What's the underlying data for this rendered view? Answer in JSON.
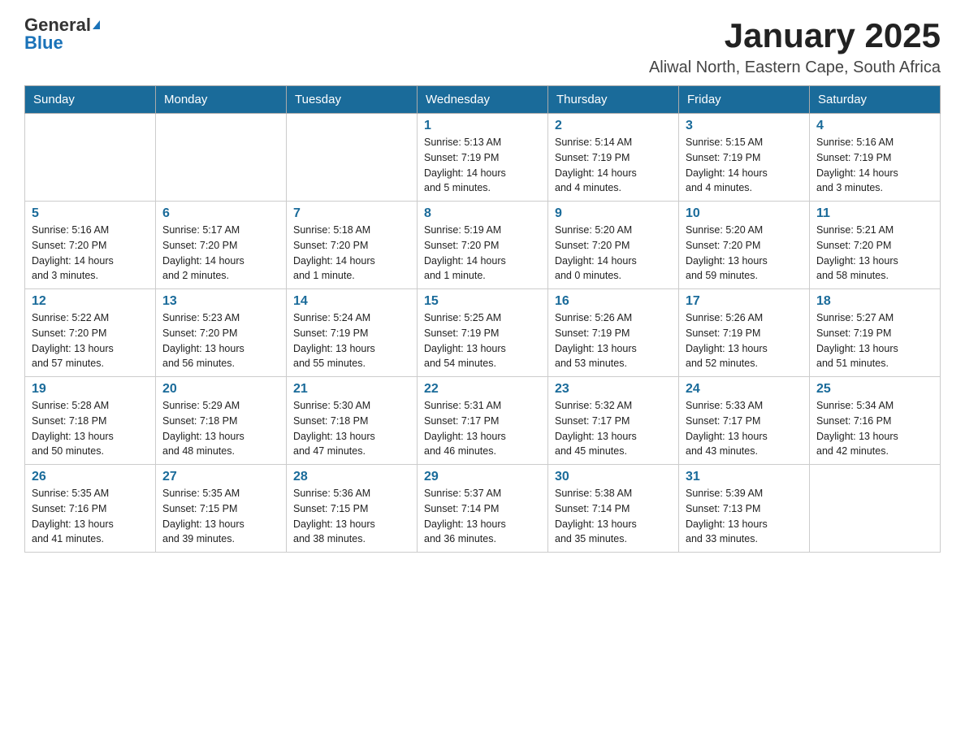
{
  "header": {
    "logo_general": "General",
    "logo_blue": "Blue",
    "main_title": "January 2025",
    "subtitle": "Aliwal North, Eastern Cape, South Africa"
  },
  "weekdays": [
    "Sunday",
    "Monday",
    "Tuesday",
    "Wednesday",
    "Thursday",
    "Friday",
    "Saturday"
  ],
  "weeks": [
    [
      {
        "day": "",
        "info": ""
      },
      {
        "day": "",
        "info": ""
      },
      {
        "day": "",
        "info": ""
      },
      {
        "day": "1",
        "info": "Sunrise: 5:13 AM\nSunset: 7:19 PM\nDaylight: 14 hours\nand 5 minutes."
      },
      {
        "day": "2",
        "info": "Sunrise: 5:14 AM\nSunset: 7:19 PM\nDaylight: 14 hours\nand 4 minutes."
      },
      {
        "day": "3",
        "info": "Sunrise: 5:15 AM\nSunset: 7:19 PM\nDaylight: 14 hours\nand 4 minutes."
      },
      {
        "day": "4",
        "info": "Sunrise: 5:16 AM\nSunset: 7:19 PM\nDaylight: 14 hours\nand 3 minutes."
      }
    ],
    [
      {
        "day": "5",
        "info": "Sunrise: 5:16 AM\nSunset: 7:20 PM\nDaylight: 14 hours\nand 3 minutes."
      },
      {
        "day": "6",
        "info": "Sunrise: 5:17 AM\nSunset: 7:20 PM\nDaylight: 14 hours\nand 2 minutes."
      },
      {
        "day": "7",
        "info": "Sunrise: 5:18 AM\nSunset: 7:20 PM\nDaylight: 14 hours\nand 1 minute."
      },
      {
        "day": "8",
        "info": "Sunrise: 5:19 AM\nSunset: 7:20 PM\nDaylight: 14 hours\nand 1 minute."
      },
      {
        "day": "9",
        "info": "Sunrise: 5:20 AM\nSunset: 7:20 PM\nDaylight: 14 hours\nand 0 minutes."
      },
      {
        "day": "10",
        "info": "Sunrise: 5:20 AM\nSunset: 7:20 PM\nDaylight: 13 hours\nand 59 minutes."
      },
      {
        "day": "11",
        "info": "Sunrise: 5:21 AM\nSunset: 7:20 PM\nDaylight: 13 hours\nand 58 minutes."
      }
    ],
    [
      {
        "day": "12",
        "info": "Sunrise: 5:22 AM\nSunset: 7:20 PM\nDaylight: 13 hours\nand 57 minutes."
      },
      {
        "day": "13",
        "info": "Sunrise: 5:23 AM\nSunset: 7:20 PM\nDaylight: 13 hours\nand 56 minutes."
      },
      {
        "day": "14",
        "info": "Sunrise: 5:24 AM\nSunset: 7:19 PM\nDaylight: 13 hours\nand 55 minutes."
      },
      {
        "day": "15",
        "info": "Sunrise: 5:25 AM\nSunset: 7:19 PM\nDaylight: 13 hours\nand 54 minutes."
      },
      {
        "day": "16",
        "info": "Sunrise: 5:26 AM\nSunset: 7:19 PM\nDaylight: 13 hours\nand 53 minutes."
      },
      {
        "day": "17",
        "info": "Sunrise: 5:26 AM\nSunset: 7:19 PM\nDaylight: 13 hours\nand 52 minutes."
      },
      {
        "day": "18",
        "info": "Sunrise: 5:27 AM\nSunset: 7:19 PM\nDaylight: 13 hours\nand 51 minutes."
      }
    ],
    [
      {
        "day": "19",
        "info": "Sunrise: 5:28 AM\nSunset: 7:18 PM\nDaylight: 13 hours\nand 50 minutes."
      },
      {
        "day": "20",
        "info": "Sunrise: 5:29 AM\nSunset: 7:18 PM\nDaylight: 13 hours\nand 48 minutes."
      },
      {
        "day": "21",
        "info": "Sunrise: 5:30 AM\nSunset: 7:18 PM\nDaylight: 13 hours\nand 47 minutes."
      },
      {
        "day": "22",
        "info": "Sunrise: 5:31 AM\nSunset: 7:17 PM\nDaylight: 13 hours\nand 46 minutes."
      },
      {
        "day": "23",
        "info": "Sunrise: 5:32 AM\nSunset: 7:17 PM\nDaylight: 13 hours\nand 45 minutes."
      },
      {
        "day": "24",
        "info": "Sunrise: 5:33 AM\nSunset: 7:17 PM\nDaylight: 13 hours\nand 43 minutes."
      },
      {
        "day": "25",
        "info": "Sunrise: 5:34 AM\nSunset: 7:16 PM\nDaylight: 13 hours\nand 42 minutes."
      }
    ],
    [
      {
        "day": "26",
        "info": "Sunrise: 5:35 AM\nSunset: 7:16 PM\nDaylight: 13 hours\nand 41 minutes."
      },
      {
        "day": "27",
        "info": "Sunrise: 5:35 AM\nSunset: 7:15 PM\nDaylight: 13 hours\nand 39 minutes."
      },
      {
        "day": "28",
        "info": "Sunrise: 5:36 AM\nSunset: 7:15 PM\nDaylight: 13 hours\nand 38 minutes."
      },
      {
        "day": "29",
        "info": "Sunrise: 5:37 AM\nSunset: 7:14 PM\nDaylight: 13 hours\nand 36 minutes."
      },
      {
        "day": "30",
        "info": "Sunrise: 5:38 AM\nSunset: 7:14 PM\nDaylight: 13 hours\nand 35 minutes."
      },
      {
        "day": "31",
        "info": "Sunrise: 5:39 AM\nSunset: 7:13 PM\nDaylight: 13 hours\nand 33 minutes."
      },
      {
        "day": "",
        "info": ""
      }
    ]
  ]
}
